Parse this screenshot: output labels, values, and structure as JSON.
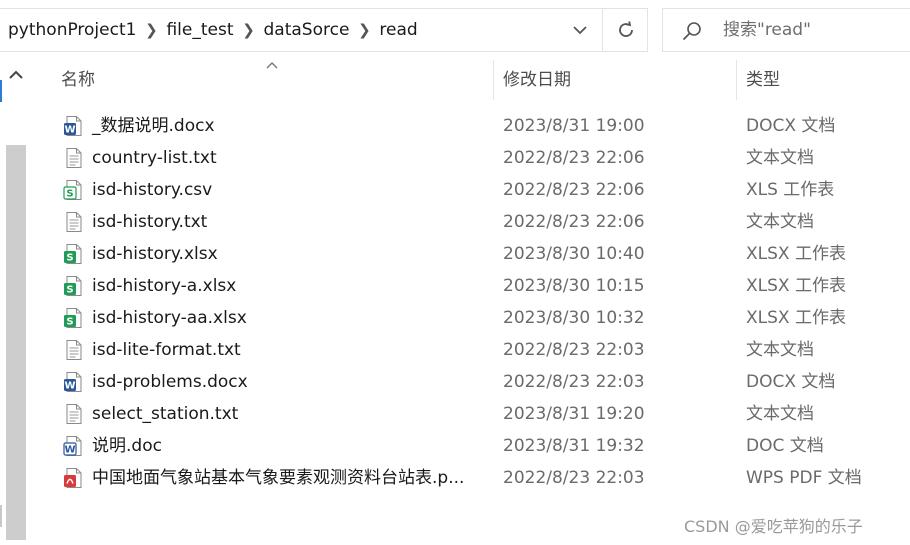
{
  "address_bar": {
    "crumbs": [
      "pythonProject1",
      "file_test",
      "dataSorce",
      "read"
    ]
  },
  "search": {
    "placeholder": "搜索\"read\""
  },
  "columns": {
    "name": "名称",
    "date": "修改日期",
    "type": "类型"
  },
  "files": [
    {
      "icon": "word-doc-icon",
      "name": "_数据说明.docx",
      "date": "2023/8/31 19:00",
      "type": "DOCX 文档"
    },
    {
      "icon": "text-file-icon",
      "name": "country-list.txt",
      "date": "2022/8/23 22:06",
      "type": "文本文档"
    },
    {
      "icon": "csv-sheet-icon",
      "name": "isd-history.csv",
      "date": "2022/8/23 22:06",
      "type": "XLS 工作表"
    },
    {
      "icon": "text-file-icon",
      "name": "isd-history.txt",
      "date": "2022/8/23 22:06",
      "type": "文本文档"
    },
    {
      "icon": "xlsx-sheet-icon",
      "name": "isd-history.xlsx",
      "date": "2023/8/30 10:40",
      "type": "XLSX 工作表"
    },
    {
      "icon": "xlsx-sheet-icon",
      "name": "isd-history-a.xlsx",
      "date": "2023/8/30 10:15",
      "type": "XLSX 工作表"
    },
    {
      "icon": "xlsx-sheet-icon",
      "name": "isd-history-aa.xlsx",
      "date": "2023/8/30 10:32",
      "type": "XLSX 工作表"
    },
    {
      "icon": "text-file-icon",
      "name": "isd-lite-format.txt",
      "date": "2022/8/23 22:03",
      "type": "文本文档"
    },
    {
      "icon": "word-doc-icon",
      "name": "isd-problems.docx",
      "date": "2022/8/23 22:03",
      "type": "DOCX 文档"
    },
    {
      "icon": "text-file-icon",
      "name": "select_station.txt",
      "date": "2023/8/31 19:20",
      "type": "文本文档"
    },
    {
      "icon": "word-doc-legacy-icon",
      "name": "说明.doc",
      "date": "2023/8/31 19:32",
      "type": "DOC 文档"
    },
    {
      "icon": "pdf-file-icon",
      "name": "中国地面气象站基本气象要素观测资料台站表.p...",
      "date": "2022/8/23 22:03",
      "type": "WPS PDF 文档"
    }
  ],
  "watermark": "CSDN @爱吃苹狗的乐子",
  "colors": {
    "word_blue": "#2b579a",
    "sheet_green": "#1f9d55",
    "pdf_red": "#d93b3b",
    "scrollbar": "#cdcdcd"
  }
}
